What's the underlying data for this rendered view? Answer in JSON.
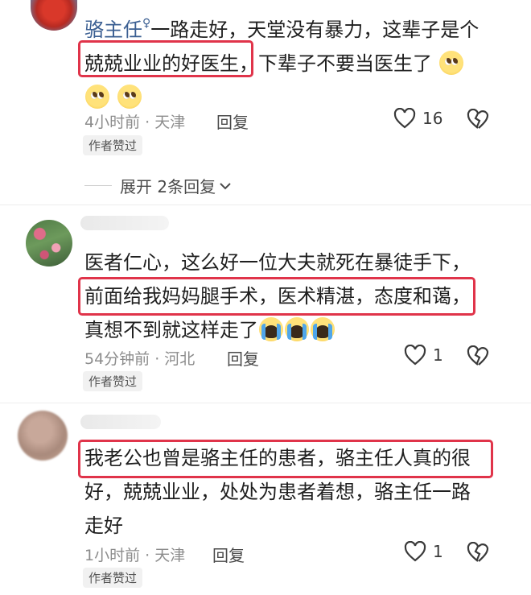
{
  "comments": [
    {
      "name": "骆主任",
      "name_suffix": "♀",
      "lines": [
        "一路走好，天堂没有暴力，这辈子是个",
        "兢兢业业的好医生",
        "，下辈子不要当医生了"
      ],
      "meta": "4小时前 · 天津",
      "reply": "回复",
      "likes": "16",
      "badge": "作者赞过",
      "expand": "展开 2条回复"
    },
    {
      "lines": [
        "医者仁心，这么好一位大夫就死在暴徒手下，",
        "前面给我妈妈腿手术，医术精湛，态度和蔼，",
        "真想不到就这样走了"
      ],
      "meta": "54分钟前 · 河北",
      "reply": "回复",
      "likes": "1",
      "badge": "作者赞过"
    },
    {
      "lines": [
        "我老公也曾是骆主任的患者，骆主任人真的很",
        "好，兢兢业业，处处为患者着想，骆主任一路",
        "走好"
      ],
      "meta": "1小时前 · 天津",
      "reply": "回复",
      "likes": "1",
      "badge": "作者赞过"
    }
  ],
  "icons": {
    "like": "heart-outline-icon",
    "dislike": "broken-heart-icon",
    "expand": "chevron-down-icon",
    "emoji_plead": "pleading-face-emoji",
    "emoji_cry": "loudly-crying-face-emoji"
  },
  "colors": {
    "highlight": "#e0344a",
    "username": "#3b5f92"
  }
}
